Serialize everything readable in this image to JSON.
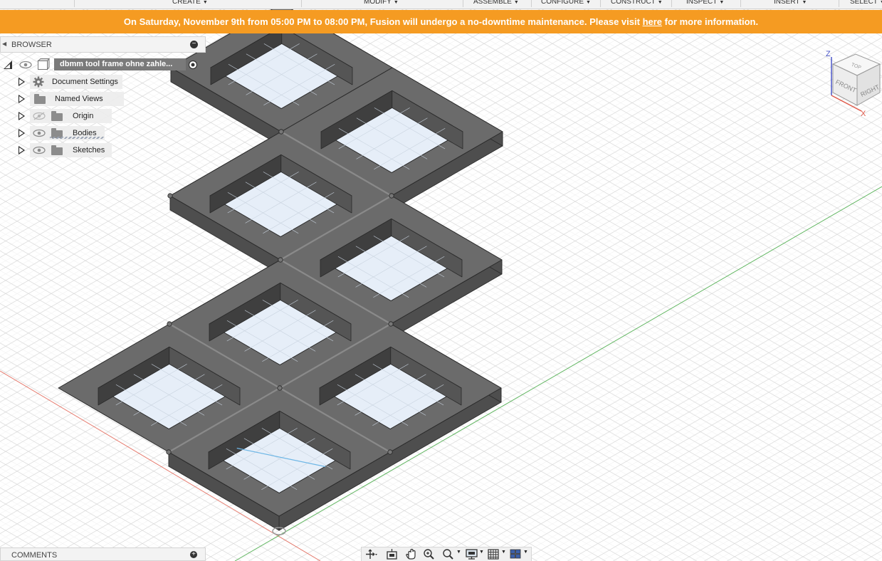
{
  "menubar": {
    "items": [
      {
        "label": "CREATE"
      },
      {
        "label": "MODIFY"
      },
      {
        "label": "ASSEMBLE"
      },
      {
        "label": "CONFIGURE"
      },
      {
        "label": "CONSTRUCT"
      },
      {
        "label": "INSPECT"
      },
      {
        "label": "INSERT"
      },
      {
        "label": "SELECT"
      }
    ]
  },
  "banner": {
    "text_before": "On Saturday, November 9th from 05:00 PM to 08:00 PM, Fusion will undergo a no-downtime maintenance. Please visit ",
    "link_text": "here",
    "text_after": " for more information.",
    "color": "#f59b22"
  },
  "browser": {
    "title": "BROWSER",
    "document_name": "dbmm tool frame ohne zahle...",
    "items": [
      {
        "label": "Document Settings",
        "icon": "gear-icon",
        "visibility": "none"
      },
      {
        "label": "Named Views",
        "icon": "folder-icon",
        "visibility": "none"
      },
      {
        "label": "Origin",
        "icon": "folder-icon",
        "visibility": "hidden"
      },
      {
        "label": "Bodies",
        "icon": "folder-icon",
        "visibility": "visible"
      },
      {
        "label": "Sketches",
        "icon": "folder-icon",
        "visibility": "visible"
      }
    ]
  },
  "comments": {
    "title": "COMMENTS"
  },
  "viewcube": {
    "axis_z": "Z",
    "axis_x": "X",
    "face_top": "TOP",
    "face_front": "FRONT",
    "face_right": "RIGHT"
  },
  "navbar": {
    "tools": [
      "orbit-icon",
      "look-at-icon",
      "pan-icon",
      "zoom-icon",
      "zoom-window-icon",
      "display-settings-icon",
      "grid-settings-icon",
      "viewports-icon"
    ]
  },
  "colors": {
    "frame_top": "#6b6b6b",
    "frame_side": "#4e4e4e",
    "inner_wall": "#3f3f3f",
    "window_fill": "#e6eef8",
    "x_axis": "#e05a4a",
    "y_axis": "#3aa33a",
    "sketch_line": "#6fb7e6"
  }
}
